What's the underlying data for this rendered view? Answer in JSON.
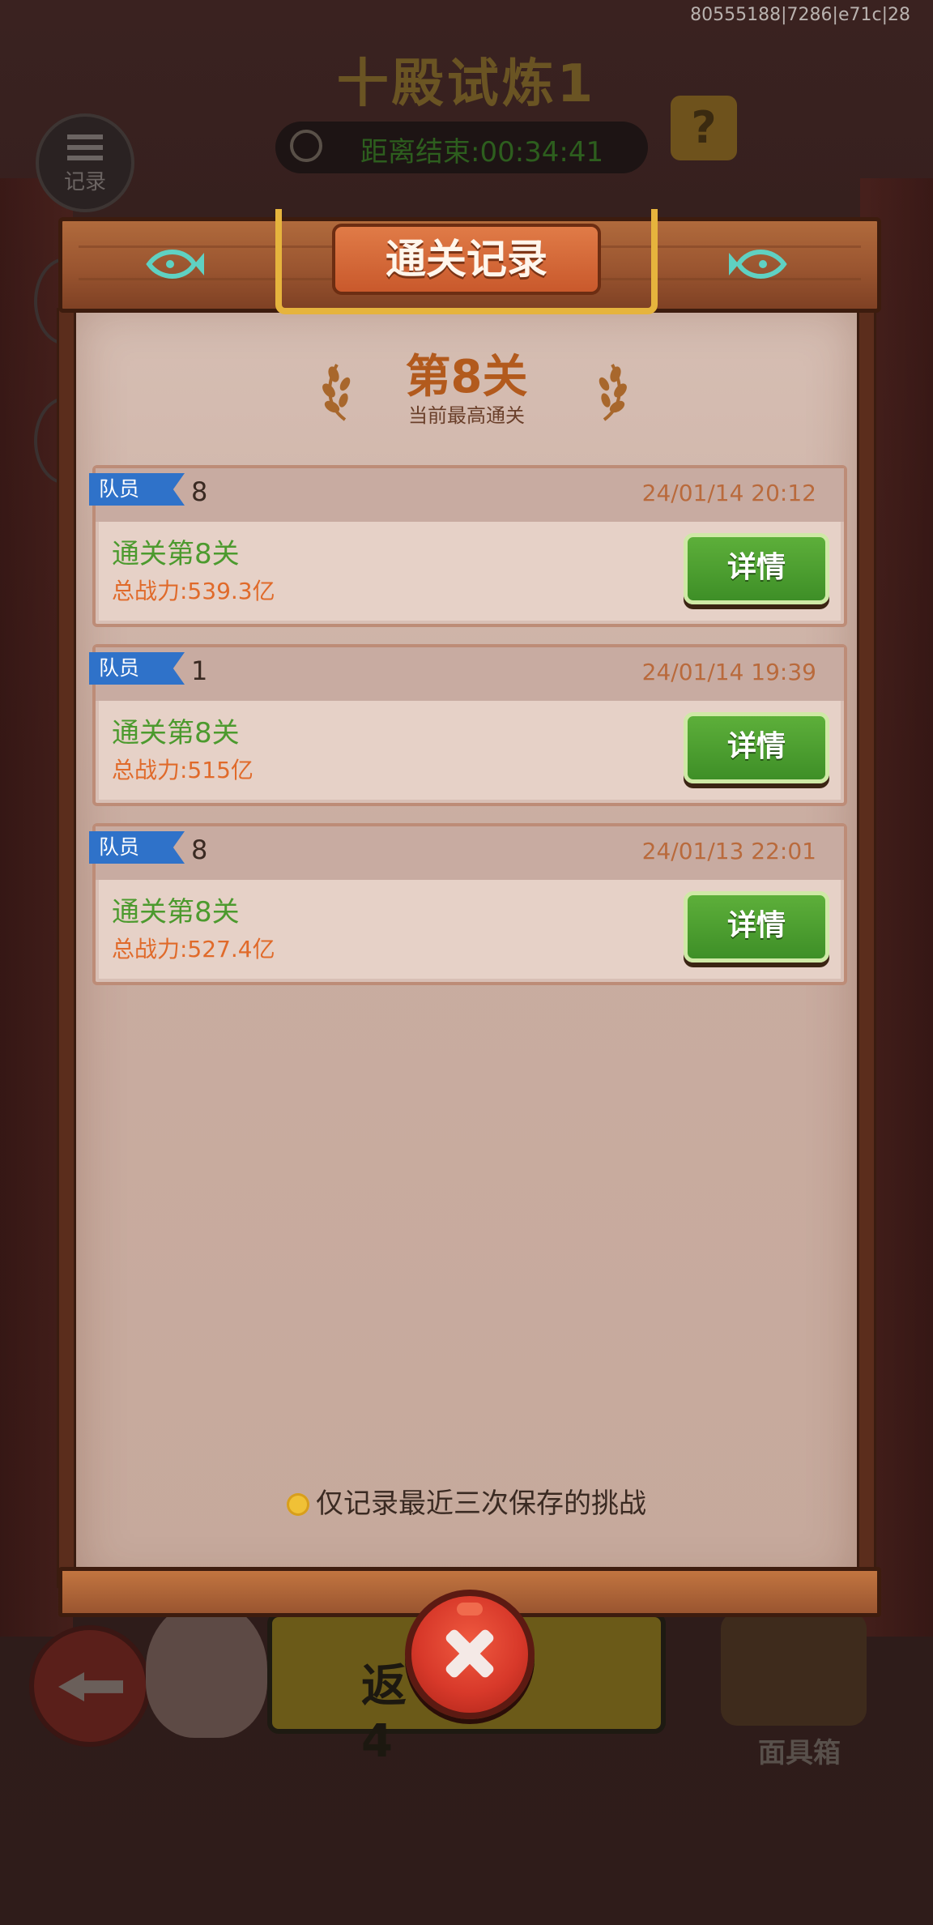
{
  "system": {
    "build_id": "80555188|7286|e71c|28"
  },
  "background": {
    "title": "十殿试炼1",
    "timer_text": "距离结束:00:34:41",
    "help_label": "?",
    "record_label": "记录",
    "start_label": "返  4",
    "mask_box_label": "面具箱"
  },
  "modal": {
    "title": "通关记录",
    "best_level": "第8关",
    "best_level_sub": "当前最高通关",
    "footer_note": "仅记录最近三次保存的挑战",
    "records": [
      {
        "member_label": "队员",
        "member_count": "8",
        "time": "24/01/14 20:12",
        "clear_text": "通关第8关",
        "power_text": "总战力:539.3亿",
        "button_label": "详情"
      },
      {
        "member_label": "队员",
        "member_count": "1",
        "time": "24/01/14 19:39",
        "clear_text": "通关第8关",
        "power_text": "总战力:515亿",
        "button_label": "详情"
      },
      {
        "member_label": "队员",
        "member_count": "8",
        "time": "24/01/13 22:01",
        "clear_text": "通关第8关",
        "power_text": "总战力:527.4亿",
        "button_label": "详情"
      }
    ]
  },
  "colors": {
    "accent_green": "#4c9a2e",
    "power_orange": "#e06a2a",
    "member_blue": "#2f72c9",
    "title_orange": "#b25a1d"
  }
}
